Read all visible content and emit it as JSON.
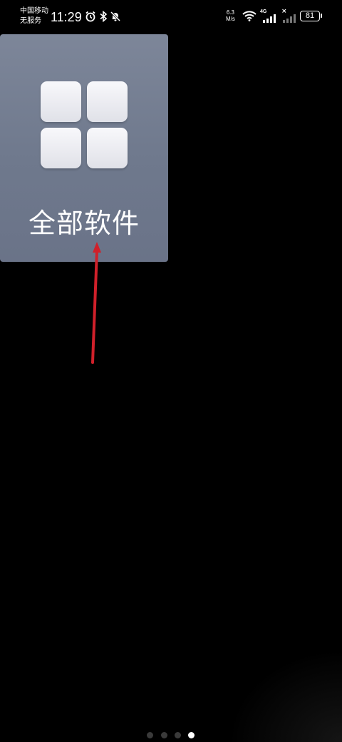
{
  "status_bar": {
    "carrier_line1": "中国移动",
    "carrier_line2": "无服务",
    "time": "11:29",
    "network_speed_value": "6.3",
    "network_speed_unit": "M/s",
    "network_type": "4G",
    "battery": "81",
    "icons": [
      "alarm-icon",
      "bluetooth-icon",
      "mute-icon",
      "wifi-icon",
      "signal-icon",
      "no-signal-icon"
    ]
  },
  "home": {
    "folder_label": "全部软件",
    "page_count": 4,
    "active_page": 4
  },
  "colors": {
    "background": "#000000",
    "folder_card": "#768094",
    "annotation_arrow": "#d0202a"
  }
}
